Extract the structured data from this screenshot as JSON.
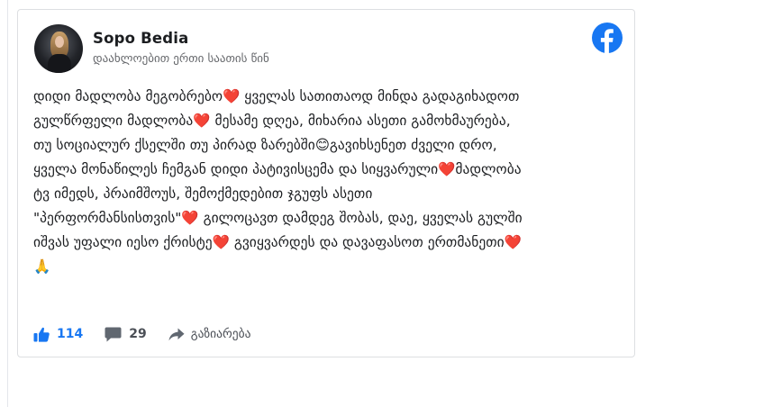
{
  "post": {
    "author": "Sopo Bedia",
    "time": "დაახლოებით ერთი საათის წინ",
    "text": "დიდი მადლობა მეგობრებო❤️ ყველას სათითაოდ მინდა გადაგიხადოთ\nგულწრფელი მადლობა❤️ მესამე დღეა, მიხარია ასეთი გამოხმაურება,\nთუ სოციალურ ქსელში თუ პირად ზარებში😊გავიხსენეთ ძველი დრო,\nყველა მონაწილეს ჩემგან დიდი პატივისცემა და სიყვარული❤️მადლობა\nტვ იმედს, პრაიმშოუს, შემოქმედებით ჯგუფს ასეთი\n\"პერფორმანსისთვის\"❤️ გილოცავთ დამდეგ შობას, დაე, ყველას გულში\nიშვას უფალი იესო ქრისტე❤️ გვიყვარდეს და დავაფასოთ ერთმანეთი❤️\n🙏"
  },
  "actions": {
    "likes": "114",
    "comments": "29",
    "share": "გაზიარება"
  },
  "icons": {
    "brand": "facebook-logo-icon",
    "like": "thumbs-up-icon",
    "comment": "comment-icon",
    "share": "share-arrow-icon"
  },
  "colors": {
    "facebook_blue": "#1877f2",
    "text": "#1c1e21",
    "muted": "#65676b",
    "action_gray": "#4b4f56"
  }
}
